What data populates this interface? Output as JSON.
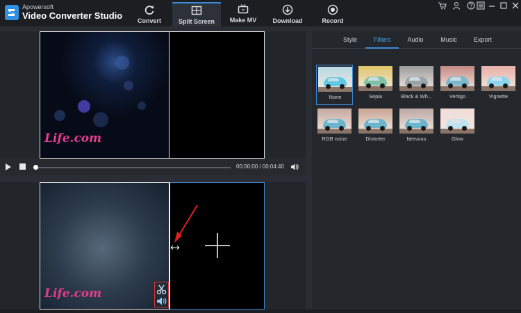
{
  "app": {
    "brand_small": "Apowersoft",
    "brand_name": "Video Converter Studio"
  },
  "toolbar": {
    "items": [
      {
        "label": "Convert",
        "icon": "refresh-icon",
        "active": false
      },
      {
        "label": "Split Screen",
        "icon": "split-screen-icon",
        "active": true
      },
      {
        "label": "Make MV",
        "icon": "tv-icon",
        "active": false
      },
      {
        "label": "Download",
        "icon": "download-icon",
        "active": false
      },
      {
        "label": "Record",
        "icon": "record-icon",
        "active": false
      }
    ]
  },
  "window_controls": [
    "cart-icon",
    "user-icon",
    "help-icon",
    "menu-icon",
    "minimize-icon",
    "maximize-icon",
    "close-icon"
  ],
  "preview": {
    "watermark": "Life.com",
    "time_display": "00:00:00 / 00:04:40",
    "progress": 0.0
  },
  "right_panel": {
    "tabs": [
      {
        "label": "Style",
        "active": false
      },
      {
        "label": "Filters",
        "active": true
      },
      {
        "label": "Audio",
        "active": false
      },
      {
        "label": "Music",
        "active": false
      },
      {
        "label": "Export",
        "active": false
      }
    ],
    "filters": [
      {
        "name": "None",
        "selected": true,
        "tint": "#b8d8e4"
      },
      {
        "name": "Sepia",
        "selected": false,
        "tint": "#e0c46a"
      },
      {
        "name": "Black & Wh...",
        "selected": false,
        "tint": "#9c9c9c"
      },
      {
        "name": "Vertigo",
        "selected": false,
        "tint": "#c48a84"
      },
      {
        "name": "Vignette",
        "selected": false,
        "tint": "#e8b0a8"
      },
      {
        "name": "RGB noise",
        "selected": false,
        "tint": "#c4a8a0"
      },
      {
        "name": "Distorter",
        "selected": false,
        "tint": "#c8a494"
      },
      {
        "name": "Nervous",
        "selected": false,
        "tint": "#bca8a4"
      },
      {
        "name": "Glow",
        "selected": false,
        "tint": "#f0dcd8"
      }
    ]
  },
  "colors": {
    "accent": "#3c8ad8",
    "background": "#2a2d33",
    "toolbar": "#1c1e22",
    "watermark": "#e23e8e",
    "annotation": "#e02020"
  }
}
